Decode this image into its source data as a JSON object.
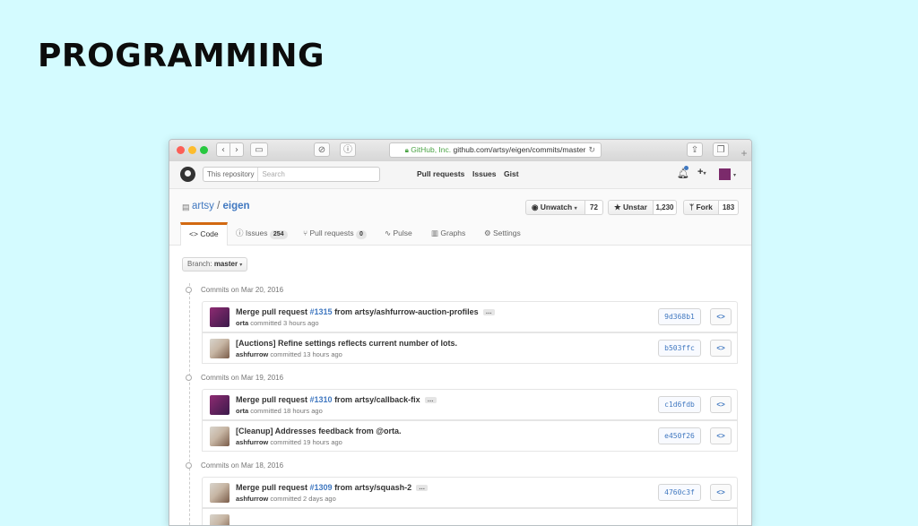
{
  "slide": {
    "title": "PROGRAMMING"
  },
  "browser": {
    "url_security": "GitHub, Inc.",
    "url_path": "github.com/artsy/eigen/commits/master"
  },
  "header": {
    "search_scope": "This repository",
    "search_placeholder": "Search",
    "nav": [
      "Pull requests",
      "Issues",
      "Gist"
    ]
  },
  "repo": {
    "owner": "artsy",
    "separator": "/",
    "name": "eigen",
    "unwatch_label": "Unwatch",
    "watch_count": "72",
    "unstar_label": "Unstar",
    "star_count": "1,230",
    "fork_label": "Fork",
    "fork_count": "183"
  },
  "tabs": {
    "code": "Code",
    "issues": "Issues",
    "issues_count": "254",
    "pulls": "Pull requests",
    "pulls_count": "0",
    "pulse": "Pulse",
    "graphs": "Graphs",
    "settings": "Settings"
  },
  "branch": {
    "label": "Branch:",
    "name": "master"
  },
  "commit_groups": [
    {
      "date": "Commits on Mar 20, 2016",
      "commits": [
        {
          "msg_pre": "Merge pull request ",
          "pr": "#1315",
          "msg_post": " from artsy/ashfurrow-auction-profiles",
          "author": "orta",
          "verb": "committed",
          "time": "3 hours ago",
          "sha": "9d368b1"
        },
        {
          "msg_pre": "[Auctions] Refine settings reflects current number of lots.",
          "pr": "",
          "msg_post": "",
          "author": "ashfurrow",
          "verb": "committed",
          "time": "13 hours ago",
          "sha": "b503ffc"
        }
      ]
    },
    {
      "date": "Commits on Mar 19, 2016",
      "commits": [
        {
          "msg_pre": "Merge pull request ",
          "pr": "#1310",
          "msg_post": " from artsy/callback-fix",
          "author": "orta",
          "verb": "committed",
          "time": "18 hours ago",
          "sha": "c1d6fdb"
        },
        {
          "msg_pre": "[Cleanup] Addresses feedback from @orta.",
          "pr": "",
          "msg_post": "",
          "author": "ashfurrow",
          "verb": "committed",
          "time": "19 hours ago",
          "sha": "e450f26"
        }
      ]
    },
    {
      "date": "Commits on Mar 18, 2016",
      "commits": [
        {
          "msg_pre": "Merge pull request ",
          "pr": "#1309",
          "msg_post": " from artsy/squash-2",
          "author": "ashfurrow",
          "verb": "committed",
          "time": "2 days ago",
          "sha": "4760c3f"
        }
      ]
    }
  ],
  "icons": {
    "browse": "<>",
    "more": "…"
  }
}
